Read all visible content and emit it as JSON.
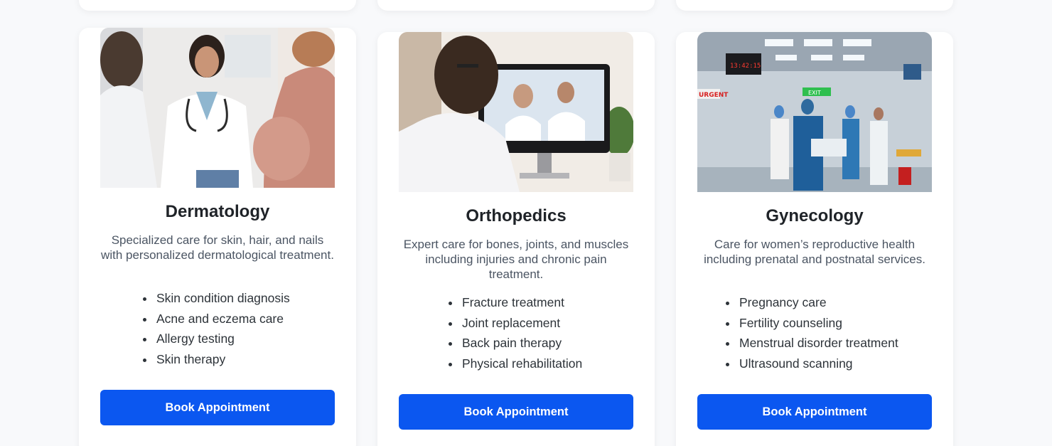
{
  "prev_cards": [
    "",
    "",
    ""
  ],
  "cards": [
    {
      "title": "Dermatology",
      "image_alt": "doctor-consulting-pregnant-patient-photo",
      "description": "Specialized care for skin, hair, and nails with personalized dermatological treatment.",
      "features": [
        "Skin condition diagnosis",
        "Acne and eczema care",
        "Allergy testing",
        "Skin therapy"
      ],
      "button_label": "Book Appointment"
    },
    {
      "title": "Orthopedics",
      "image_alt": "doctor-video-consultation-photo",
      "description": "Expert care for bones, joints, and muscles including injuries and chronic pain treatment.",
      "features": [
        "Fracture treatment",
        "Joint replacement",
        "Back pain therapy",
        "Physical rehabilitation"
      ],
      "button_label": "Book Appointment"
    },
    {
      "title": "Gynecology",
      "image_alt": "emergency-room-photo",
      "description": "Care for women’s reproductive health including prenatal and postnatal services.",
      "features": [
        "Pregnancy care",
        "Fertility counseling",
        "Menstrual disorder treatment",
        "Ultrasound scanning"
      ],
      "button_label": "Book Appointment"
    }
  ],
  "image_overlay": {
    "sign_urgent": "URGENT",
    "clock": "13:42:15",
    "exit": "EXIT"
  },
  "colors": {
    "page_bg": "#f8f9fb",
    "card_bg": "#ffffff",
    "button_bg": "#0b57f0",
    "button_text": "#ffffff",
    "title": "#1f2328",
    "body_text": "#4b5563"
  }
}
